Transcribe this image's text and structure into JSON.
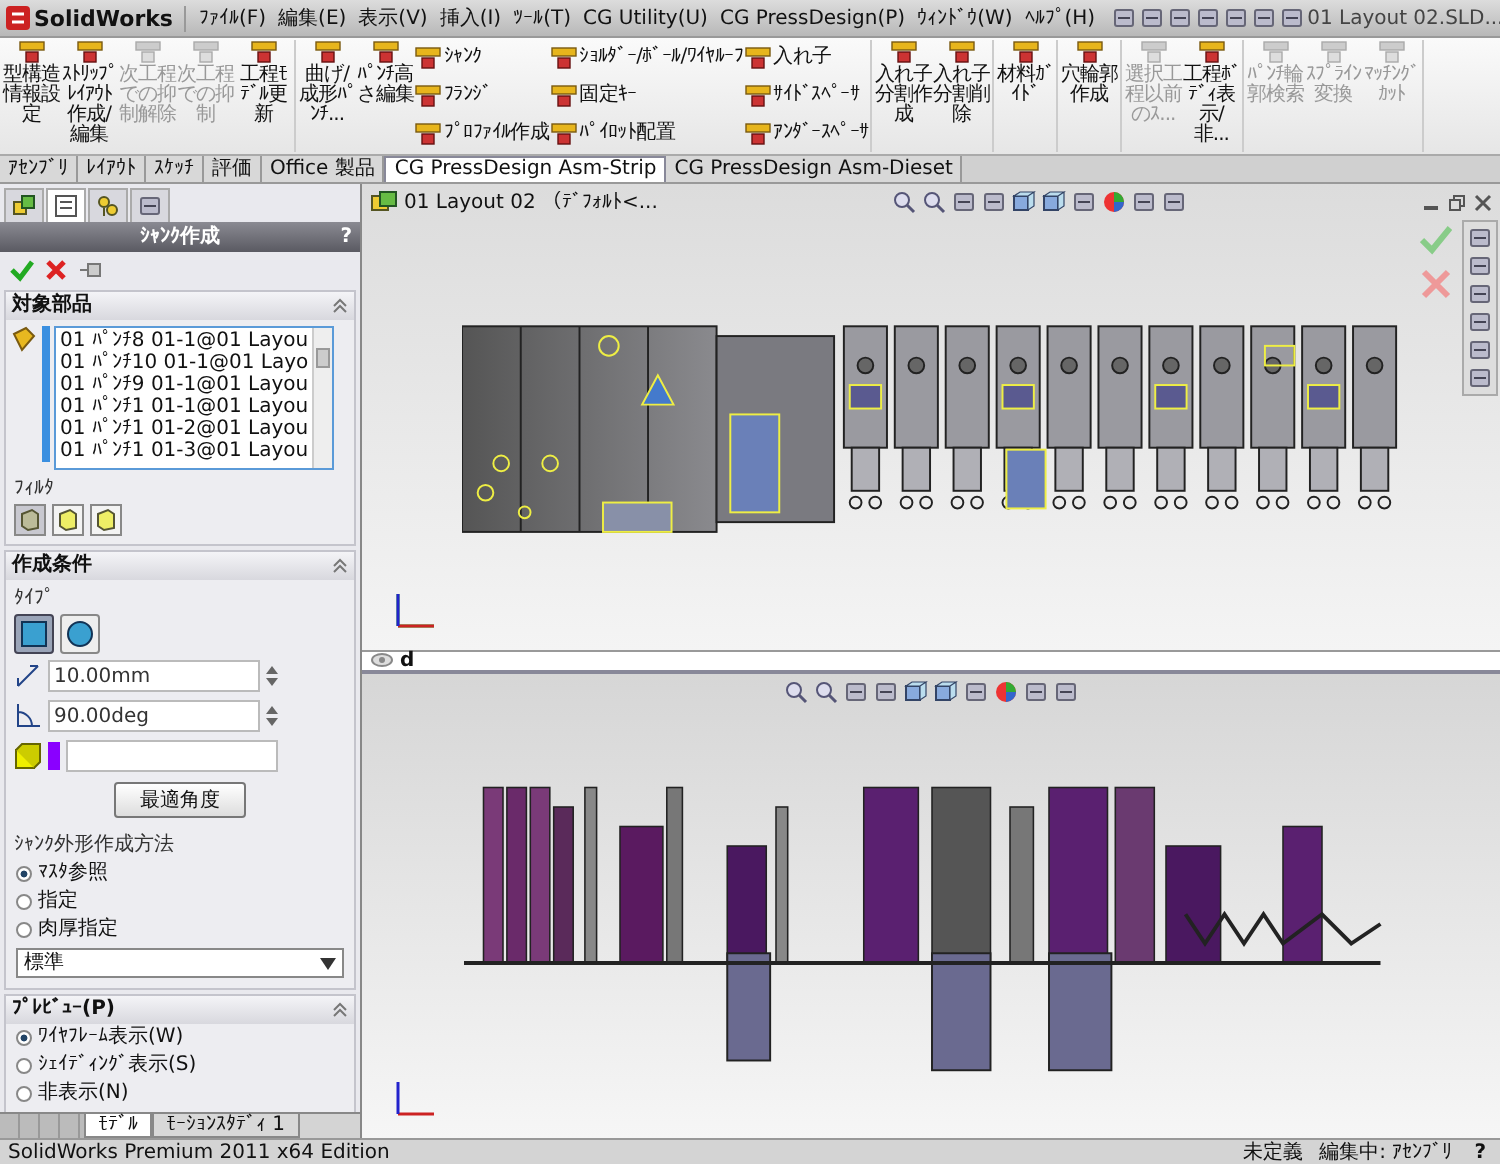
{
  "title_bar": {
    "logo": "SolidWorks",
    "document_title": "01 Layout 02.SLD...",
    "help": "?"
  },
  "menu": [
    "ﾌｧｲﾙ(F)",
    "編集(E)",
    "表示(V)",
    "挿入(I)",
    "ﾂｰﾙ(T)",
    "CG Utility(U)",
    "CG PressDesign(P)",
    "ｳｨﾝﾄﾞｳ(W)",
    "ﾍﾙﾌﾟ(H)"
  ],
  "ribbon": [
    {
      "items": [
        {
          "kind": "large",
          "label": "型構造情報設定",
          "disabled": false
        },
        {
          "kind": "large",
          "label": "ｽﾄﾘｯﾌﾟﾚｲｱｳﾄ作成/編集",
          "disabled": false
        },
        {
          "kind": "large",
          "label": "次工程での抑制解除",
          "disabled": true
        },
        {
          "kind": "large",
          "label": "次工程での抑制",
          "disabled": true
        },
        {
          "kind": "large",
          "label": "工程ﾓﾃﾞﾙ更新",
          "disabled": false
        }
      ]
    },
    {
      "items": [
        {
          "kind": "large",
          "label": "曲げ/成形ﾊﾟﾝﾁ...",
          "disabled": false
        },
        {
          "kind": "large",
          "label": "ﾊﾟﾝﾁ高さ編集",
          "disabled": false
        },
        {
          "kind": "stack",
          "labels": [
            "ｼｬﾝｸ",
            "ﾌﾗﾝｼﾞ",
            "ﾌﾟﾛﾌｧｲﾙ作成"
          ]
        },
        {
          "kind": "stack",
          "labels": [
            "ｼｮﾙﾀﾞｰ/ﾎﾞｰﾙ/ﾜｲﾔﾙｰﾌ",
            "固定ｷｰ",
            "ﾊﾟｲﾛｯﾄ配置"
          ]
        },
        {
          "kind": "stack",
          "labels": [
            "入れ子",
            "ｻｲﾄﾞｽﾍﾟｰｻ",
            "ｱﾝﾀﾞｰｽﾍﾟｰｻ"
          ]
        }
      ]
    },
    {
      "items": [
        {
          "kind": "large",
          "label": "入れ子分割作成",
          "disabled": false
        },
        {
          "kind": "large",
          "label": "入れ子分割削除",
          "disabled": false
        }
      ]
    },
    {
      "items": [
        {
          "kind": "large",
          "label": "材料ｶﾞｲﾄﾞ",
          "disabled": false
        }
      ]
    },
    {
      "items": [
        {
          "kind": "large",
          "label": "穴輪郭作成",
          "disabled": false
        }
      ]
    },
    {
      "items": [
        {
          "kind": "large",
          "label": "選択工程以前のｽ...",
          "disabled": true
        },
        {
          "kind": "large",
          "label": "工程ﾎﾞﾃﾞｨ表示/非...",
          "disabled": false
        }
      ]
    },
    {
      "items": [
        {
          "kind": "large",
          "label": "ﾊﾟﾝﾁ輪郭検索",
          "disabled": true
        },
        {
          "kind": "large",
          "label": "ｽﾌﾟﾗｲﾝ変換",
          "disabled": true
        },
        {
          "kind": "large",
          "label": "ﾏｯﾁﾝｸﾞｶｯﾄ",
          "disabled": true
        }
      ]
    }
  ],
  "command_tabs": [
    {
      "label": "ｱｾﾝﾌﾞﾘ",
      "selected": false
    },
    {
      "label": "ﾚｲｱｳﾄ",
      "selected": false
    },
    {
      "label": "ｽｹｯﾁ",
      "selected": false
    },
    {
      "label": "評価",
      "selected": false
    },
    {
      "label": "Office 製品",
      "selected": false
    },
    {
      "label": "CG PressDesign Asm-Strip",
      "selected": true
    },
    {
      "label": "CG PressDesign Asm-Dieset",
      "selected": false
    }
  ],
  "property_manager": {
    "panel_tabs": [
      {
        "kind": "tree",
        "selected": false
      },
      {
        "kind": "property",
        "selected": true
      },
      {
        "kind": "configuration",
        "selected": false
      },
      {
        "kind": "appearance",
        "selected": false
      }
    ],
    "title": "ｼｬﾝｸ作成",
    "help": "?",
    "filters": [
      {
        "kind": "component",
        "selected": true
      },
      {
        "kind": "face",
        "selected": false
      },
      {
        "kind": "edge",
        "selected": false
      }
    ],
    "target_section": {
      "heading": "対象部品",
      "items": [
        "01 ﾊﾟﾝﾁ8 01-1@01 Layou",
        "01 ﾊﾟﾝﾁ10 01-1@01 Layo",
        "01 ﾊﾟﾝﾁ9 01-1@01 Layou",
        "01 ﾊﾟﾝﾁ1 01-1@01 Layou",
        "01 ﾊﾟﾝﾁ1 01-2@01 Layou",
        "01 ﾊﾟﾝﾁ1 01-3@01 Layou"
      ],
      "filter_label": "ﾌｨﾙﾀ"
    },
    "conditions_section": {
      "heading": "作成条件",
      "type_label": "ﾀｲﾌﾟ",
      "types": [
        {
          "kind": "square",
          "selected": true
        },
        {
          "kind": "circle",
          "selected": false
        }
      ],
      "distance": "10.00mm",
      "angle": "90.00deg",
      "color": "#8a00ff",
      "optimal_button": "最適角度",
      "method_label": "ｼｬﾝｸ外形作成方法",
      "methods": [
        {
          "label": "ﾏｽﾀ参照",
          "selected": true
        },
        {
          "label": "指定",
          "selected": false
        },
        {
          "label": "肉厚指定",
          "selected": false
        }
      ],
      "dropdown": "標準"
    },
    "preview_section": {
      "heading": "ﾌﾟﾚﾋﾞｭｰ(P)",
      "options": [
        {
          "label": "ﾜｲﾔﾌﾚｰﾑ表示(W)",
          "selected": true
        },
        {
          "label": "ｼｪｲﾃﾞｨﾝｸﾞ表示(S)",
          "selected": false
        },
        {
          "label": "非表示(N)",
          "selected": false
        }
      ]
    }
  },
  "viewport": {
    "tree_item": "01 Layout 02 （ﾃﾞﾌｫﾙﾄ<...",
    "divider_label": "d"
  },
  "model_tabs": [
    {
      "label": "ﾓﾃﾞﾙ",
      "selected": true
    },
    {
      "label": "ﾓｰｼｮﾝｽﾀﾃﾞｨ 1",
      "selected": false
    }
  ],
  "status_bar": {
    "product": "SolidWorks Premium 2011 x64 Edition",
    "state": "未定義",
    "mode": "編集中: ｱｾﾝﾌﾞﾘ"
  }
}
